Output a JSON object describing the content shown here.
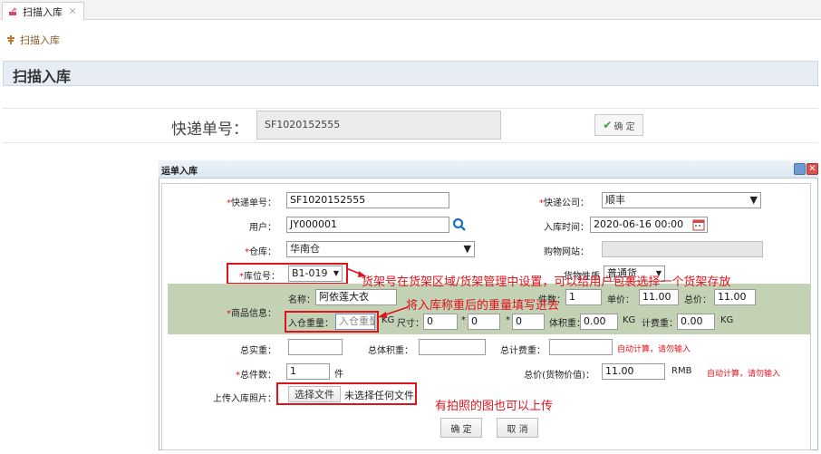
{
  "tab": {
    "title": "扫描入库",
    "close": "×"
  },
  "breadcrumb": {
    "label": "扫描入库"
  },
  "page": {
    "title": "扫描入库"
  },
  "scan": {
    "label": "快递单号：",
    "value": "SF1020152555",
    "confirm": "确 定"
  },
  "dialog": {
    "title": "运单入库",
    "tracking": {
      "label": "快递单号：",
      "value": "SF1020152555"
    },
    "courier": {
      "label": "快递公司：",
      "value": "顺丰"
    },
    "user": {
      "label": "用户：",
      "value": "JY000001"
    },
    "intime": {
      "label": "入库时间：",
      "value": "2020-06-16 00:00"
    },
    "warehouse": {
      "label": "仓库：",
      "value": "华南仓"
    },
    "site": {
      "label": "购物网站：",
      "value": ""
    },
    "location": {
      "label": "库位号：",
      "value": "B1-019"
    },
    "goods_nature": {
      "label": "货物性质",
      "value": "普通货"
    },
    "goods": {
      "label": "商品信息：",
      "name_label": "名称：",
      "name_value": "阿依莲大衣",
      "count_label": "件数：",
      "count_value": "1",
      "price_label": "单价：",
      "price_value": "11.00",
      "total_label": "总价：",
      "total_value": "11.00",
      "weight_label": "入仓重量：",
      "weight_placeholder": "入仓重量",
      "kg": "KG",
      "size_label": "尺寸：",
      "dim1": "0",
      "dim2": "0",
      "dim3": "0",
      "times": "*",
      "volweight_label": "体积重：",
      "volweight_value": "0.00",
      "chargeweight_label": "计费重：",
      "chargeweight_value": "0.00"
    },
    "totalweight": {
      "label": "总实重："
    },
    "totalvol": {
      "label": "总体积重："
    },
    "totalcharge": {
      "label": "总计费重：",
      "hint": "自动计算，请勿输入"
    },
    "totalcount": {
      "label": "总件数：",
      "value": "1",
      "unit": "件"
    },
    "totalvalue": {
      "label": "总价(货物价值)：",
      "value": "11.00",
      "unit": "RMB",
      "hint": "自动计算，请勿输入"
    },
    "photo": {
      "label": "上传入库照片：",
      "button": "选择文件",
      "status": "未选择任何文件"
    },
    "ok": "确 定",
    "cancel": "取 消"
  },
  "annotations": {
    "shelf": "货架号在货架区域/货架管理中设置，可以给用户包裹选择一个货架存放",
    "weight": "将入库称重后的重量填写进去",
    "photo": "有拍照的图也可以上传"
  },
  "colors": {
    "annotation": "#e0121b",
    "green_row": "#c3d1b5",
    "search_icon": "#1f6fbf"
  }
}
